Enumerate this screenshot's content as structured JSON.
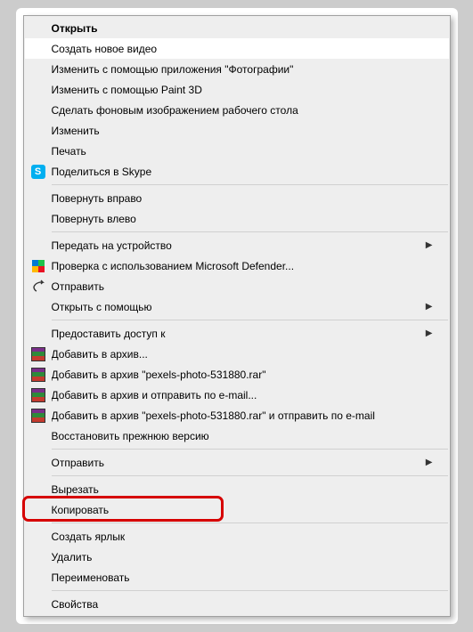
{
  "menu": {
    "items": [
      {
        "label": "Открыть",
        "bold": true
      },
      {
        "label": "Создать новое видео",
        "hovered": true
      },
      {
        "label": "Изменить с помощью приложения \"Фотографии\""
      },
      {
        "label": "Изменить с помощью Paint 3D"
      },
      {
        "label": "Сделать фоновым изображением рабочего стола"
      },
      {
        "label": "Изменить"
      },
      {
        "label": "Печать"
      },
      {
        "label": "Поделиться в Skype",
        "icon": "skype"
      },
      {
        "sep": true
      },
      {
        "label": "Повернуть вправо"
      },
      {
        "label": "Повернуть влево"
      },
      {
        "sep": true
      },
      {
        "label": "Передать на устройство",
        "submenu": true
      },
      {
        "label": "Проверка с использованием Microsoft Defender...",
        "icon": "shield"
      },
      {
        "label": "Отправить",
        "icon": "share"
      },
      {
        "label": "Открыть с помощью",
        "submenu": true
      },
      {
        "sep": true
      },
      {
        "label": "Предоставить доступ к",
        "submenu": true
      },
      {
        "label": "Добавить в архив...",
        "icon": "winrar"
      },
      {
        "label": "Добавить в архив \"pexels-photo-531880.rar\"",
        "icon": "winrar"
      },
      {
        "label": "Добавить в архив и отправить по e-mail...",
        "icon": "winrar"
      },
      {
        "label": "Добавить в архив \"pexels-photo-531880.rar\" и отправить по e-mail",
        "icon": "winrar"
      },
      {
        "label": "Восстановить прежнюю версию"
      },
      {
        "sep": true
      },
      {
        "label": "Отправить",
        "submenu": true
      },
      {
        "sep": true
      },
      {
        "label": "Вырезать"
      },
      {
        "label": "Копировать",
        "highlight": true
      },
      {
        "sep": true
      },
      {
        "label": "Создать ярлык"
      },
      {
        "label": "Удалить"
      },
      {
        "label": "Переименовать"
      },
      {
        "sep": true
      },
      {
        "label": "Свойства"
      }
    ]
  },
  "icons": {
    "skype": "skype-icon",
    "shield": "defender-shield-icon",
    "share": "share-icon",
    "winrar": "winrar-icon"
  },
  "highlight_color": "#d60000"
}
